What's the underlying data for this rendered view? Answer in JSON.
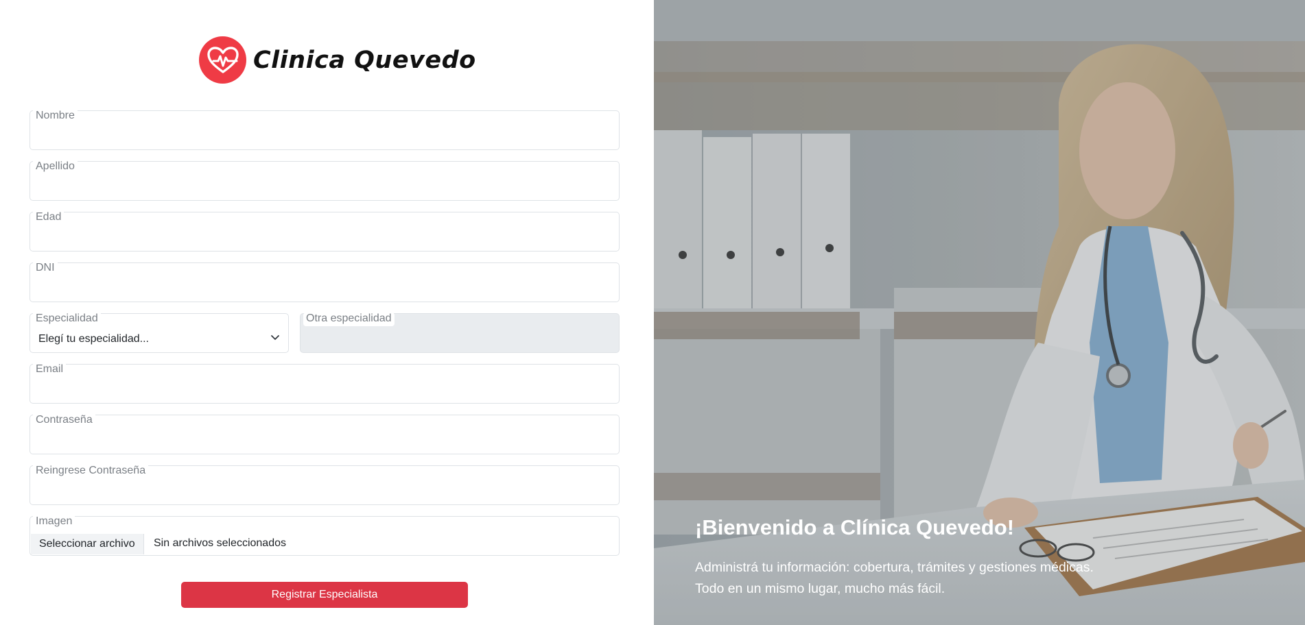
{
  "brand": {
    "name": "Clinica Quevedo",
    "logo_icon": "heart-pulse-icon",
    "logo_color": "#ef3b45"
  },
  "form": {
    "fields": {
      "nombre": {
        "label": "Nombre",
        "value": ""
      },
      "apellido": {
        "label": "Apellido",
        "value": ""
      },
      "edad": {
        "label": "Edad",
        "value": ""
      },
      "dni": {
        "label": "DNI",
        "value": ""
      },
      "especialidad": {
        "label": "Especialidad",
        "selected": "Elegí tu especialidad..."
      },
      "otra_especialidad": {
        "label": "Otra especialidad",
        "value": "",
        "disabled": true
      },
      "email": {
        "label": "Email",
        "value": ""
      },
      "contrasena": {
        "label": "Contraseña",
        "value": ""
      },
      "reingrese": {
        "label": "Reingrese Contraseña",
        "value": ""
      },
      "imagen": {
        "label": "Imagen",
        "button_label": "Seleccionar archivo",
        "status": "Sin archivos seleccionados"
      }
    },
    "submit_label": "Registrar Especialista",
    "submit_color": "#dc3545"
  },
  "hero": {
    "title": "¡Bienvenido a Clínica Quevedo!",
    "subtitle_line1": "Administrá tu información: cobertura, trámites y gestiones médicas.",
    "subtitle_line2": "Todo en un mismo lugar, mucho más fácil."
  }
}
